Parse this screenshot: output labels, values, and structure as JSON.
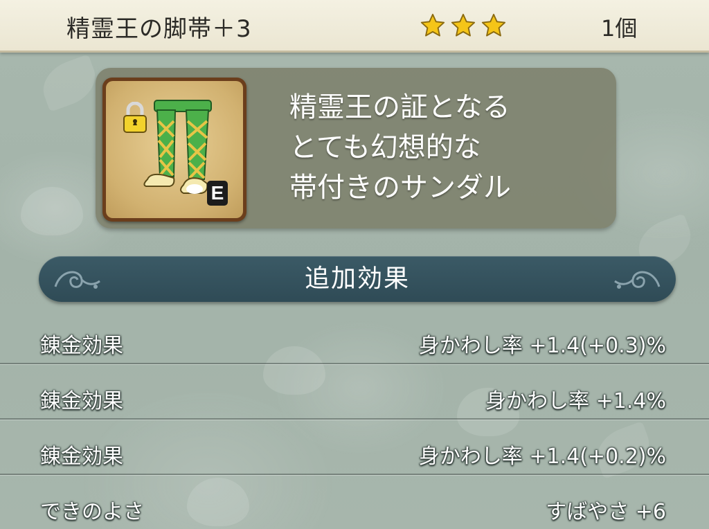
{
  "header": {
    "item_name": "精霊王の脚帯＋3",
    "stars": 3,
    "count": "1個"
  },
  "item": {
    "icon": "green-sandals-icon",
    "lock_icon": "lock-icon",
    "equipped_badge": "E",
    "description_lines": [
      "精霊王の証となる",
      "とても幻想的な",
      "帯付きのサンダル"
    ]
  },
  "section": {
    "title": "追加効果"
  },
  "effects": [
    {
      "label": "錬金効果",
      "value": "身かわし率 +1.4(+0.3)%"
    },
    {
      "label": "錬金効果",
      "value": "身かわし率 +1.4%"
    },
    {
      "label": "錬金効果",
      "value": "身かわし率 +1.4(+0.2)%"
    },
    {
      "label": "できのよさ",
      "value": "すばやさ +6"
    }
  ],
  "colors": {
    "header_bg": "#f4f1e2",
    "banner_bg": "#2f4b56",
    "star": "#f5c518",
    "pants": "#4cb04a"
  }
}
